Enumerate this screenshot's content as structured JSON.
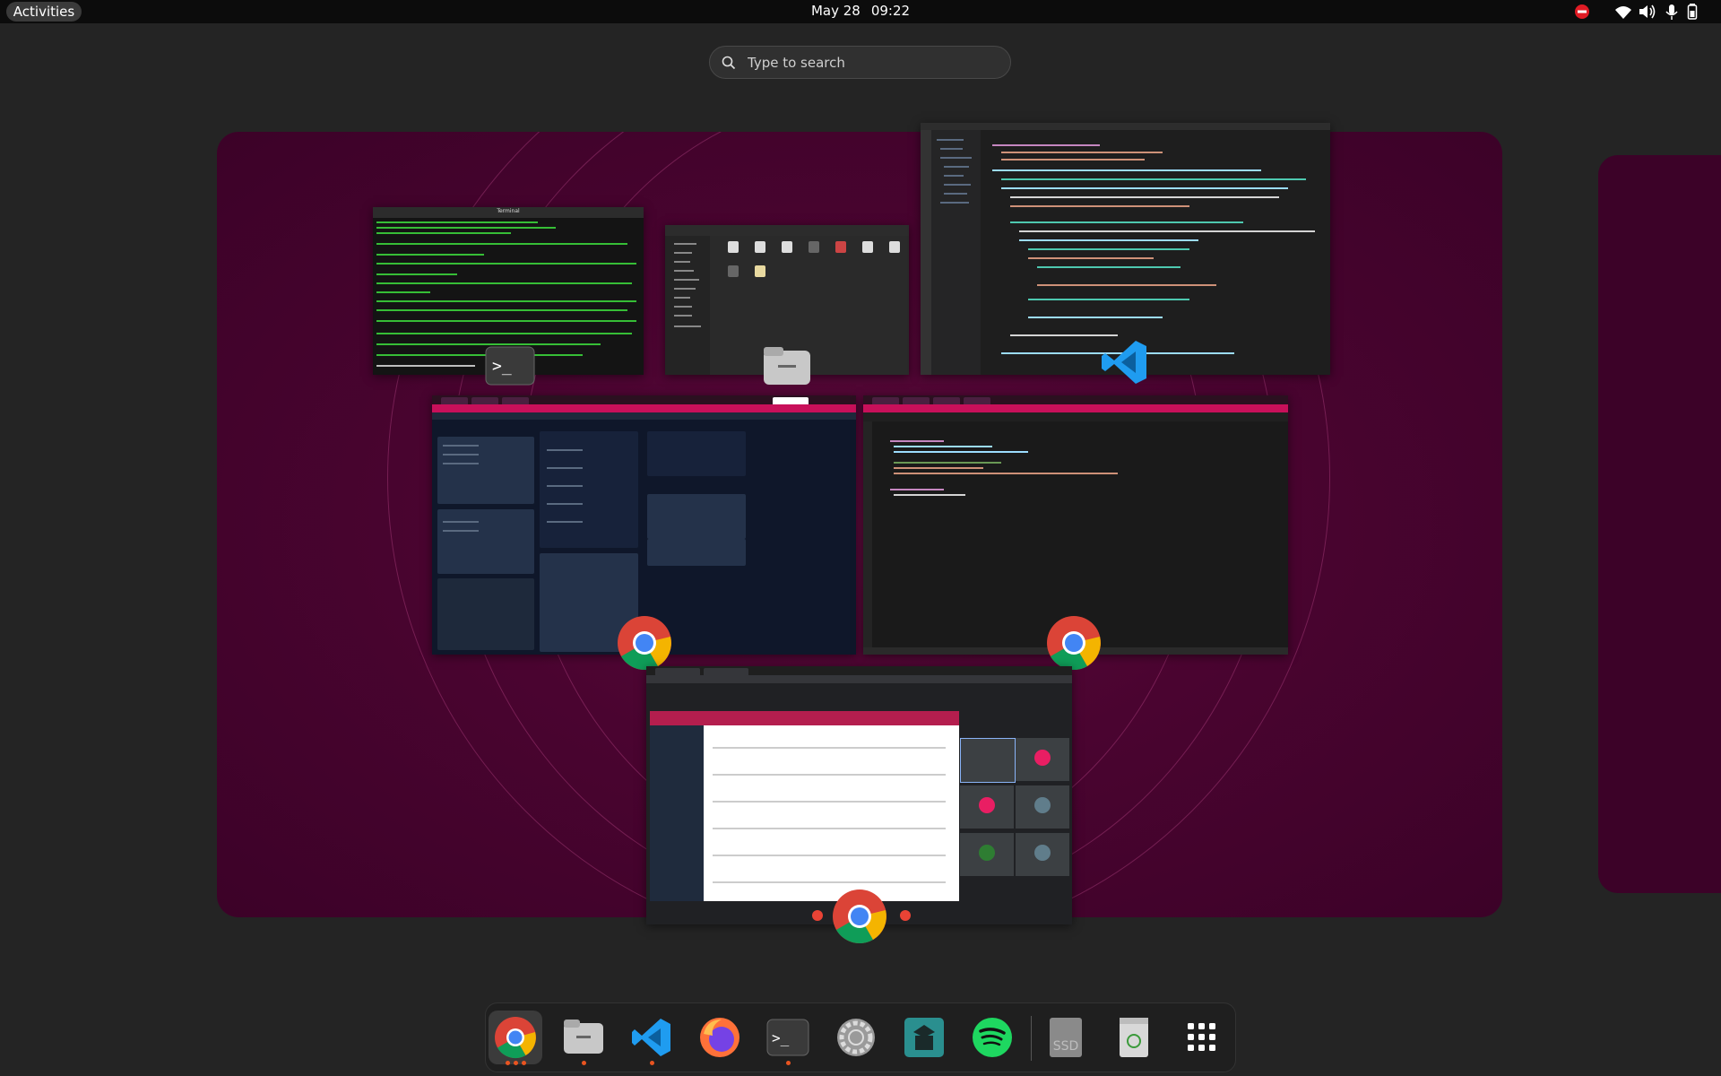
{
  "topbar": {
    "activities_label": "Activities",
    "date": "May 28",
    "time": "09:22",
    "tray_icons": [
      "do-not-disturb-icon",
      "wifi-icon",
      "volume-icon",
      "microphone-icon",
      "battery-icon"
    ]
  },
  "search": {
    "placeholder": "Type to search"
  },
  "windows": [
    {
      "app": "Terminal",
      "title": "Terminal",
      "icon": "terminal-icon"
    },
    {
      "app": "Files",
      "icon": "files-icon"
    },
    {
      "app": "Visual Studio Code",
      "icon": "vscode-icon"
    },
    {
      "app": "Google Chrome",
      "icon": "chrome-icon"
    },
    {
      "app": "Google Chrome",
      "icon": "chrome-icon"
    },
    {
      "app": "Google Chrome",
      "icon": "chrome-icon"
    }
  ],
  "dock": {
    "items": [
      {
        "name": "Google Chrome",
        "icon": "chrome-icon",
        "running": true,
        "windows": 3
      },
      {
        "name": "Files",
        "icon": "files-icon",
        "running": true,
        "windows": 1
      },
      {
        "name": "Visual Studio Code",
        "icon": "vscode-icon",
        "running": true,
        "windows": 1
      },
      {
        "name": "Firefox",
        "icon": "firefox-icon",
        "running": false,
        "windows": 0
      },
      {
        "name": "Terminal",
        "icon": "terminal-icon",
        "running": true,
        "windows": 1
      },
      {
        "name": "Settings",
        "icon": "settings-gear-icon",
        "running": false,
        "windows": 0
      },
      {
        "name": "Software",
        "icon": "software-store-icon",
        "running": false,
        "windows": 0
      },
      {
        "name": "Spotify",
        "icon": "spotify-icon",
        "running": false,
        "windows": 0
      },
      {
        "name": "SSD",
        "icon": "ssd-drive-icon",
        "label": "SSD",
        "running": false,
        "windows": 0
      },
      {
        "name": "Trash",
        "icon": "trash-icon",
        "running": false,
        "windows": 0
      },
      {
        "name": "Show Applications",
        "icon": "app-grid-icon",
        "running": false,
        "windows": 0
      }
    ]
  },
  "colors": {
    "accent": "#e95420",
    "workspace": "#4a0430",
    "terminal_text": "#3cdc3c",
    "chrome_red": "#c8105a"
  }
}
